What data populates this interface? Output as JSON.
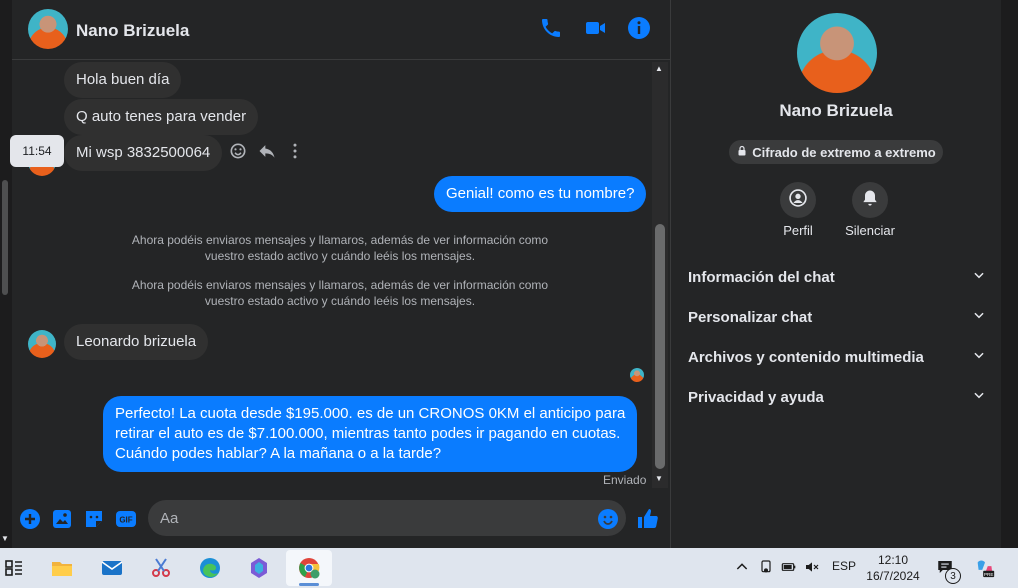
{
  "contact": {
    "name": "Nano Brizuela"
  },
  "messages": {
    "in1": "Hola buen día",
    "in2": "Q auto tenes para vender",
    "in3": "Mi wsp 3832500064",
    "tooltip_time": "11:54",
    "out1": "Genial! como es tu nombre?",
    "sys1_line1": "Ahora podéis enviaros mensajes y llamaros, además de ver información como",
    "sys1_line2": "vuestro estado activo y cuándo leéis los mensajes.",
    "sys2_line1": "Ahora podéis enviaros mensajes y llamaros, además de ver información como",
    "sys2_line2": "vuestro estado activo y cuándo leéis los mensajes.",
    "in4": "Leonardo brizuela",
    "out2_line1": "Perfecto! La cuota desde $195.000. es de un CRONOS 0KM el anticipo para",
    "out2_line2": "retirar el auto es de $7.100.000, mientras tanto podes ir pagando en cuotas.",
    "out2_line3": "Cuándo podes hablar? A la mañana o a la tarde?",
    "status": "Enviado"
  },
  "composer": {
    "placeholder": "Aa"
  },
  "panel": {
    "name": "Nano Brizuela",
    "encryption": "Cifrado de extremo a extremo",
    "profile_label": "Perfil",
    "mute_label": "Silenciar",
    "sections": [
      "Información del chat",
      "Personalizar chat",
      "Archivos y contenido multimedia",
      "Privacidad y ayuda"
    ]
  },
  "taskbar": {
    "lang": "ESP",
    "time": "12:10",
    "date": "16/7/2024",
    "notif_count": "3"
  },
  "colors": {
    "accent": "#0a7cff",
    "background": "#242526",
    "incoming": "#303030"
  }
}
